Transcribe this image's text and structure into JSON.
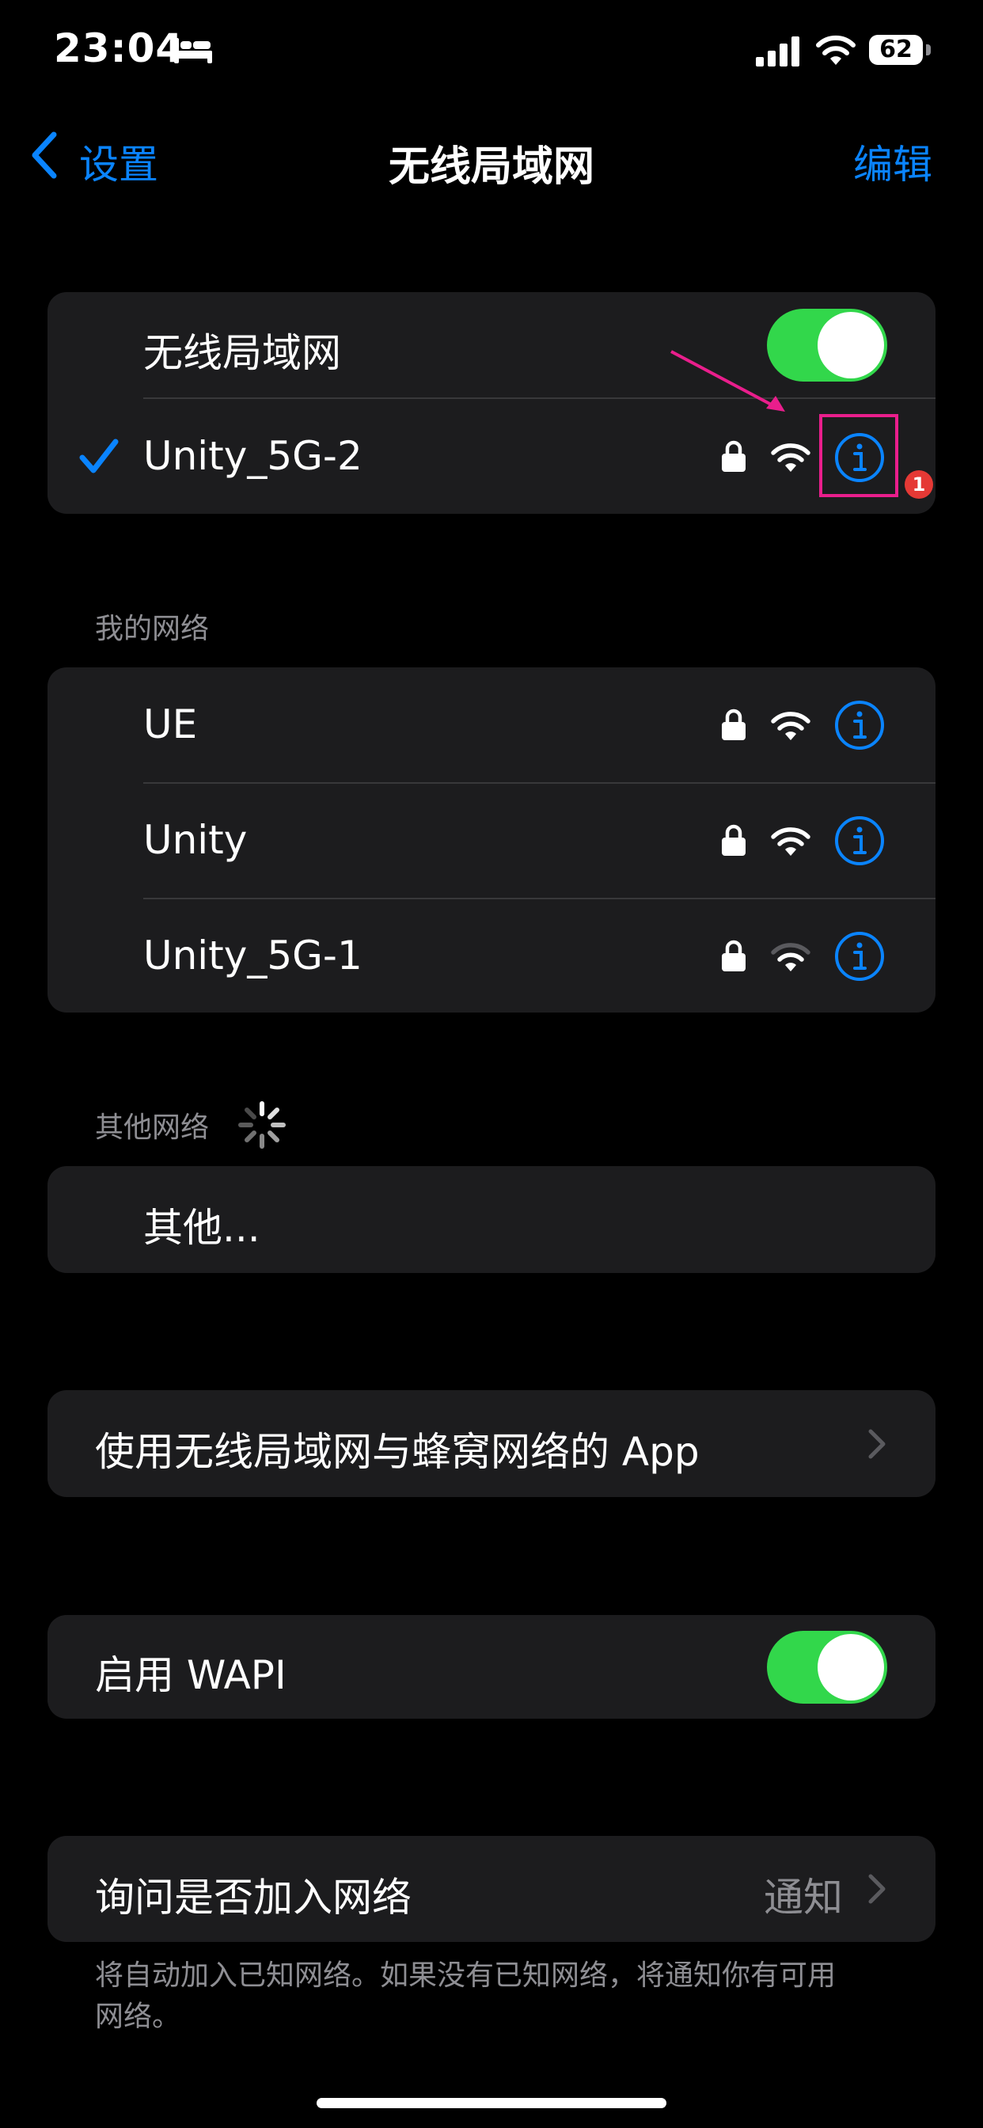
{
  "status_bar": {
    "time": "23:04",
    "sleep_icon": "bed-icon",
    "battery": "62"
  },
  "nav": {
    "back_label": "设置",
    "title": "无线局域网",
    "edit_label": "编辑"
  },
  "wifi_group": {
    "toggle_label": "无线局域网",
    "toggle_on": true,
    "connected_network": "Unity_5G-2",
    "annotation_badge": "1"
  },
  "my_networks": {
    "header": "我的网络",
    "items": [
      {
        "name": "UE"
      },
      {
        "name": "Unity"
      },
      {
        "name": "Unity_5G-1"
      }
    ]
  },
  "other_networks": {
    "header": "其他网络",
    "other_label": "其他..."
  },
  "apps_row": {
    "label": "使用无线局域网与蜂窝网络的 App"
  },
  "wapi_row": {
    "label": "启用 WAPI",
    "toggle_on": true
  },
  "ask_join": {
    "label": "询问是否加入网络",
    "value": "通知",
    "footer": "将自动加入已知网络。如果没有已知网络，将通知你有可用网络。"
  },
  "colors": {
    "accent": "#0a84ff",
    "toggle_on": "#32d74b",
    "group_bg": "#1c1c1e",
    "annotation": "#e91e8c"
  }
}
